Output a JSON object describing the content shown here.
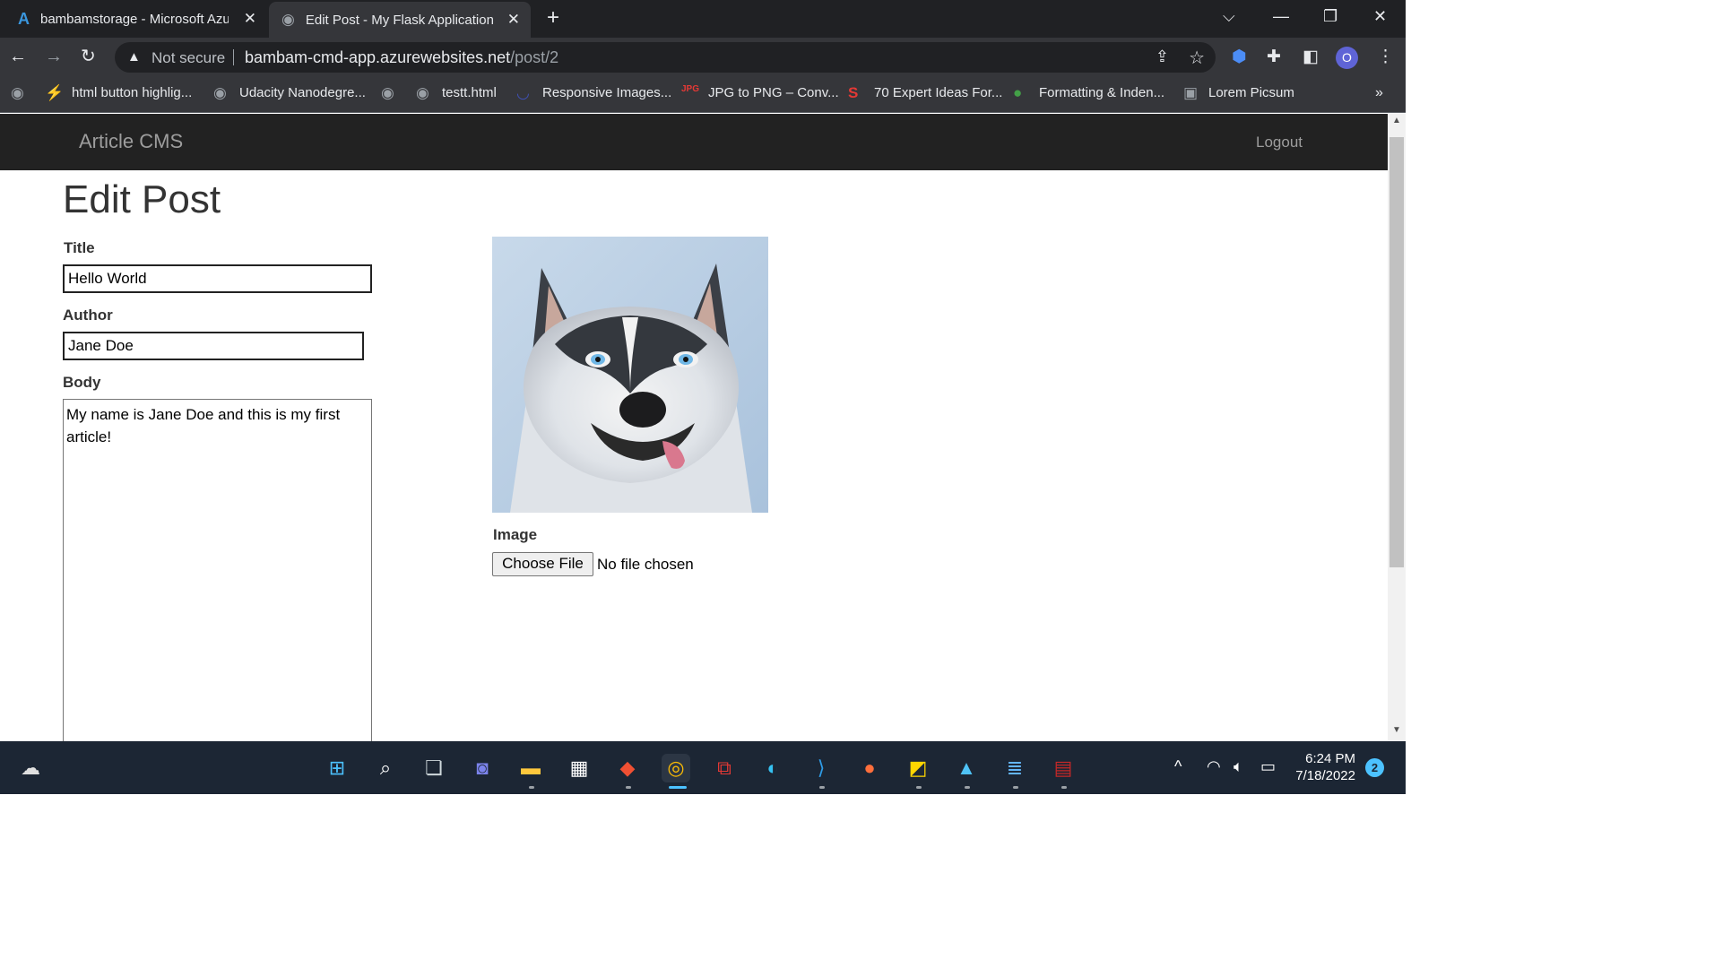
{
  "browser": {
    "tabs": [
      {
        "title": "bambamstorage - Microsoft Azure",
        "active": false
      },
      {
        "title": "Edit Post - My Flask Application",
        "active": true
      }
    ],
    "security_label": "Not secure",
    "url_host": "bambam-cmd-app.azurewebsites.net",
    "url_path": "/post/2",
    "profile_initial": "O",
    "bookmarks": [
      {
        "label": "html button highlig..."
      },
      {
        "label": "Udacity Nanodegre..."
      },
      {
        "label": ""
      },
      {
        "label": "testt.html"
      },
      {
        "label": "Responsive Images..."
      },
      {
        "label": "JPG to PNG – Conv..."
      },
      {
        "label": "70 Expert Ideas For..."
      },
      {
        "label": "Formatting & Inden..."
      },
      {
        "label": "Lorem Picsum"
      }
    ],
    "bookmarks_more": "»"
  },
  "app": {
    "brand": "Article CMS",
    "logout_label": "Logout"
  },
  "form": {
    "heading": "Edit Post",
    "title_label": "Title",
    "title_value": "Hello World",
    "author_label": "Author",
    "author_value": "Jane Doe",
    "body_label": "Body",
    "body_value": "My name is Jane Doe and this is my first article!",
    "image_label": "Image",
    "file_button": "Choose File",
    "file_status": "No file chosen"
  },
  "taskbar": {
    "time": "6:24 PM",
    "date": "7/18/2022",
    "notification_count": "2"
  },
  "colors": {
    "chrome_dark": "#202124",
    "chrome_toolbar": "#35363a",
    "app_navbar": "#222222",
    "taskbar": "#1c2634"
  }
}
